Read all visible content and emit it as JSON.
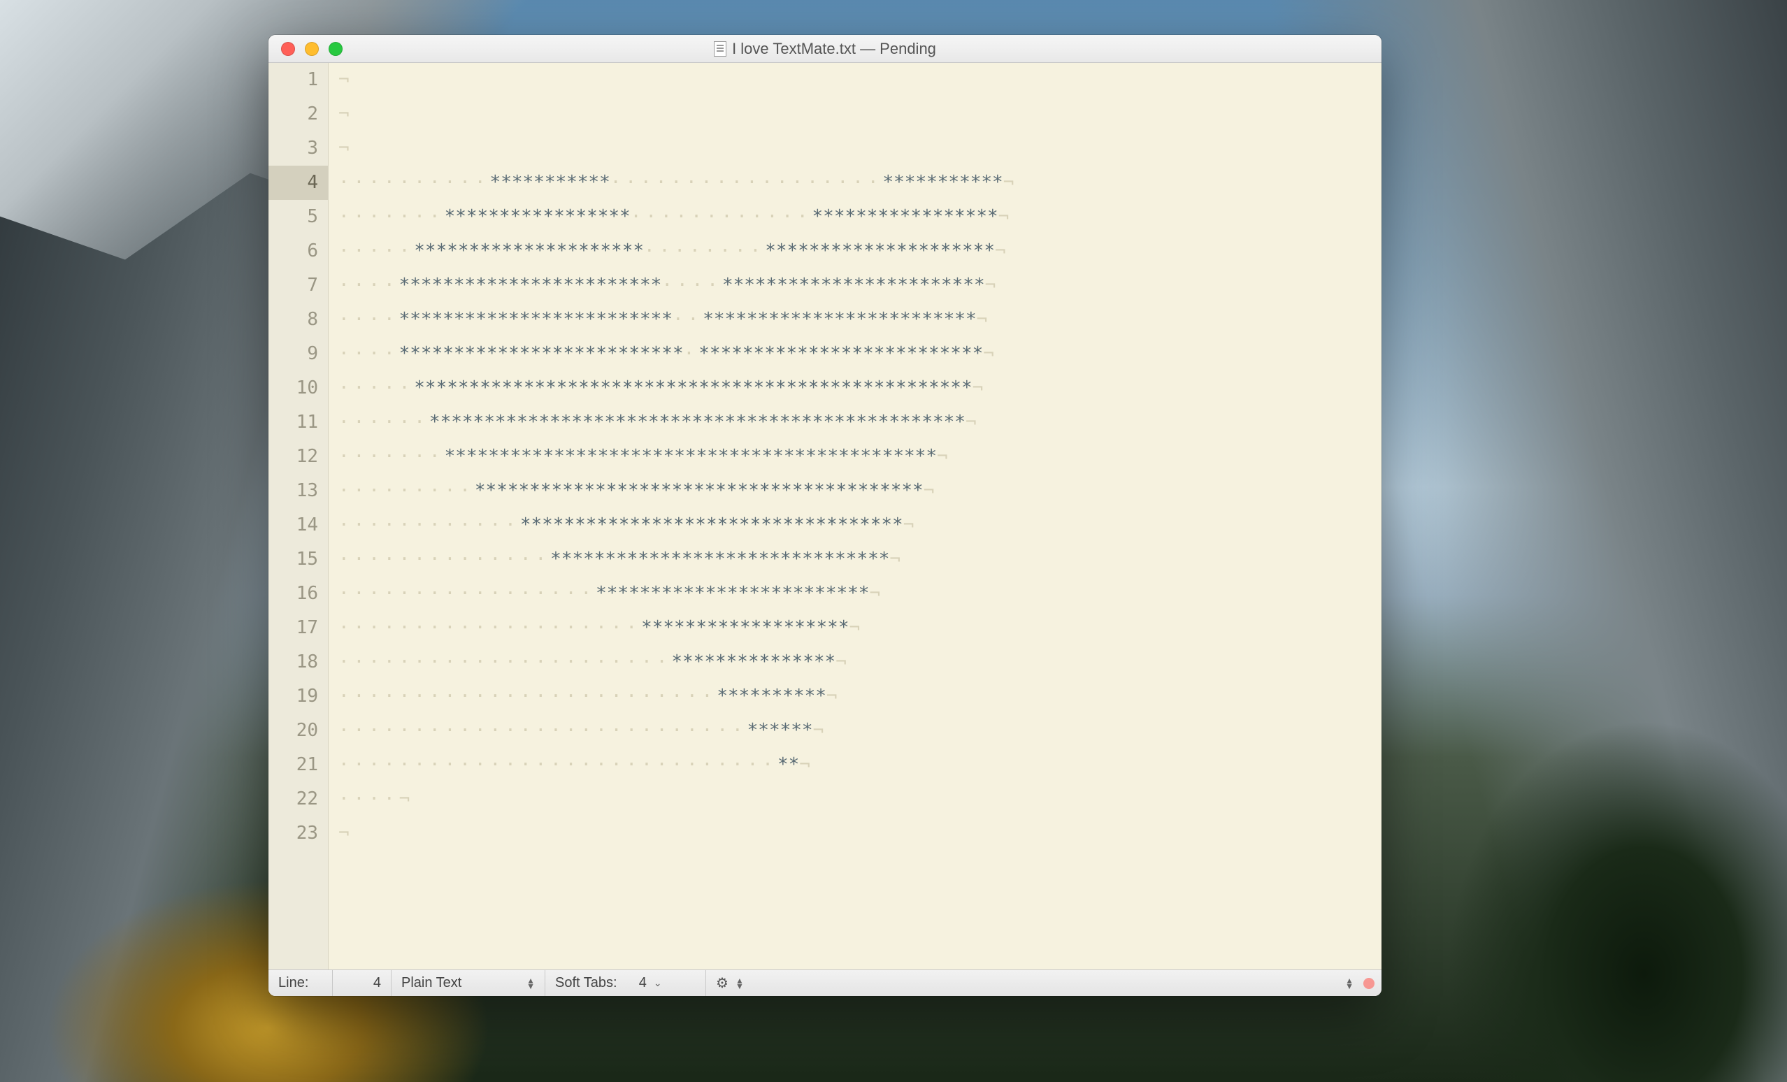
{
  "window": {
    "title": "I love TextMate.txt — Pending"
  },
  "editor": {
    "current_line": 4,
    "lines": [
      {
        "n": 1,
        "pre": 0,
        "stars1": 0,
        "gap": 0,
        "stars2": 0
      },
      {
        "n": 2,
        "pre": 0,
        "stars1": 0,
        "gap": 0,
        "stars2": 0
      },
      {
        "n": 3,
        "pre": 0,
        "stars1": 0,
        "gap": 0,
        "stars2": 0
      },
      {
        "n": 4,
        "pre": 10,
        "stars1": 11,
        "gap": 18,
        "stars2": 11
      },
      {
        "n": 5,
        "pre": 7,
        "stars1": 17,
        "gap": 12,
        "stars2": 17
      },
      {
        "n": 6,
        "pre": 5,
        "stars1": 21,
        "gap": 8,
        "stars2": 21
      },
      {
        "n": 7,
        "pre": 4,
        "stars1": 24,
        "gap": 4,
        "stars2": 24
      },
      {
        "n": 8,
        "pre": 4,
        "stars1": 25,
        "gap": 2,
        "stars2": 25
      },
      {
        "n": 9,
        "pre": 4,
        "stars1": 26,
        "gap": 1,
        "stars2": 26
      },
      {
        "n": 10,
        "pre": 5,
        "stars1": 51,
        "gap": 0,
        "stars2": 0
      },
      {
        "n": 11,
        "pre": 6,
        "stars1": 49,
        "gap": 0,
        "stars2": 0
      },
      {
        "n": 12,
        "pre": 7,
        "stars1": 45,
        "gap": 0,
        "stars2": 0
      },
      {
        "n": 13,
        "pre": 9,
        "stars1": 41,
        "gap": 0,
        "stars2": 0
      },
      {
        "n": 14,
        "pre": 12,
        "stars1": 35,
        "gap": 0,
        "stars2": 0
      },
      {
        "n": 15,
        "pre": 14,
        "stars1": 31,
        "gap": 0,
        "stars2": 0
      },
      {
        "n": 16,
        "pre": 17,
        "stars1": 25,
        "gap": 0,
        "stars2": 0
      },
      {
        "n": 17,
        "pre": 20,
        "stars1": 19,
        "gap": 0,
        "stars2": 0
      },
      {
        "n": 18,
        "pre": 22,
        "stars1": 15,
        "gap": 0,
        "stars2": 0
      },
      {
        "n": 19,
        "pre": 25,
        "stars1": 10,
        "gap": 0,
        "stars2": 0
      },
      {
        "n": 20,
        "pre": 27,
        "stars1": 6,
        "gap": 0,
        "stars2": 0
      },
      {
        "n": 21,
        "pre": 29,
        "stars1": 2,
        "gap": 0,
        "stars2": 0
      },
      {
        "n": 22,
        "pre": 4,
        "stars1": 0,
        "gap": 0,
        "stars2": 0
      },
      {
        "n": 23,
        "pre": 0,
        "stars1": 0,
        "gap": 0,
        "stars2": 0
      }
    ]
  },
  "status": {
    "line_label": "Line:",
    "line_value": "4",
    "language": "Plain Text",
    "soft_tabs_label": "Soft Tabs:",
    "soft_tabs_value": "4"
  }
}
